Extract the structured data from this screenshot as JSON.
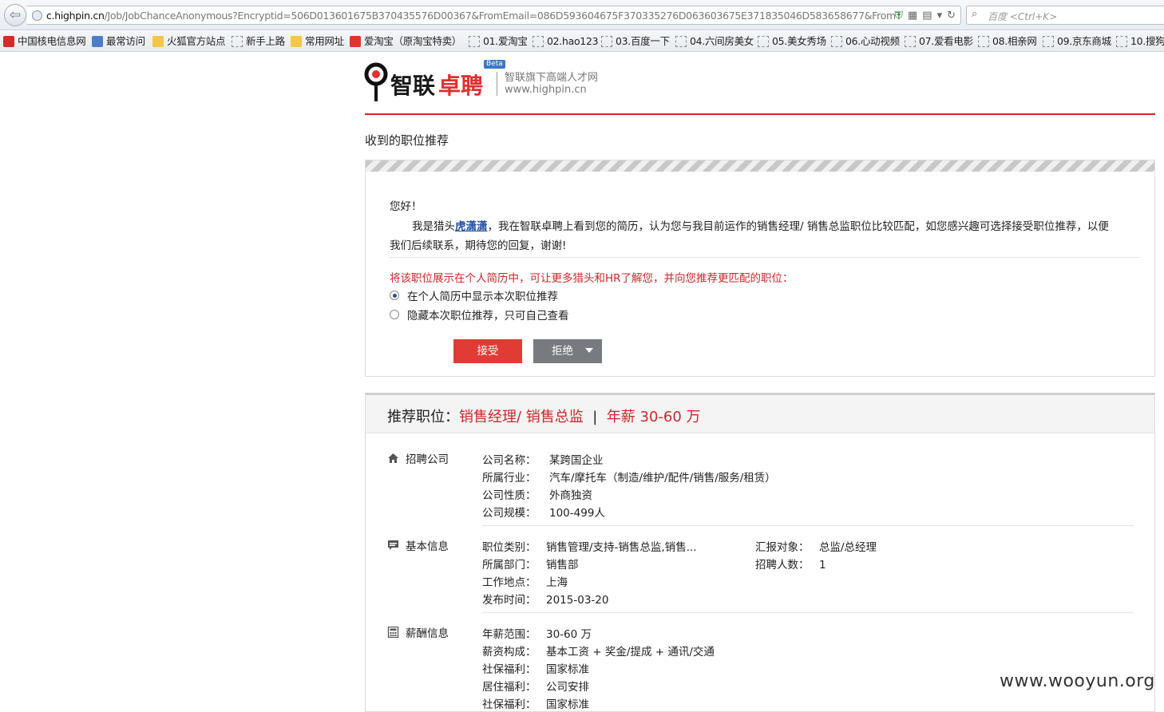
{
  "browser": {
    "url_host": "c.highpin.cn",
    "url_path": "/Job/JobChanceAnonymous?Encryptid=506D013601675B370435576D00367&FromEmail=086D593604675F370335276D063603675E371835046D583658677&FromType=",
    "search_placeholder": "百度 <Ctrl+K>"
  },
  "bookmarks": [
    {
      "label": "中国核电信息网",
      "icon": "red"
    },
    {
      "label": "最常访问",
      "icon": "blue"
    },
    {
      "label": "火狐官方站点",
      "icon": "folder"
    },
    {
      "label": "新手上路",
      "icon": "blank"
    },
    {
      "label": "常用网址",
      "icon": "folder"
    },
    {
      "label": "爱淘宝（原淘宝特卖）",
      "icon": "tao"
    },
    {
      "label": "01.爱淘宝",
      "icon": "blank"
    },
    {
      "label": "02.hao123",
      "icon": "blank"
    },
    {
      "label": "03.百度一下",
      "icon": "blank"
    },
    {
      "label": "04.六间房美女",
      "icon": "blank"
    },
    {
      "label": "05.美女秀场",
      "icon": "blank"
    },
    {
      "label": "06.心动视频",
      "icon": "blank"
    },
    {
      "label": "07.爱看电影",
      "icon": "blank"
    },
    {
      "label": "08.相亲网",
      "icon": "blank"
    },
    {
      "label": "09.京东商城",
      "icon": "blank"
    },
    {
      "label": "10.搜狗",
      "icon": "blank"
    }
  ],
  "logo": {
    "name_a": "智联",
    "name_b": "卓聘",
    "beta": "Beta",
    "slogan": "智联旗下高端人才网",
    "domain": "www.highpin.cn"
  },
  "page_title": "收到的职位推荐",
  "message": {
    "greeting": "您好！",
    "p1_before": "我是猎头",
    "hunter_name": "虎潇潇",
    "p1_after": "，我在智联卓聘上看到您的简历，认为您与我目前运作的销售经理/ 销售总监职位比较匹配，如您感兴趣可选择接受职位推荐，以便",
    "p2": "我们后续联系，期待您的回复，谢谢!",
    "prompt": "将该职位展示在个人简历中，可让更多猎头和HR了解您，并向您推荐更匹配的职位：",
    "option_show": "在个人简历中显示本次职位推荐",
    "option_hide": "隐藏本次职位推荐，只可自己查看",
    "accept": "接受",
    "reject": "拒绝"
  },
  "job": {
    "head_label": "推荐职位：",
    "title": "销售经理/ 销售总监",
    "bar": "|",
    "salary": "年薪 30-60 万",
    "company": {
      "section": "招聘公司",
      "rows": [
        {
          "k": "公司名称：",
          "v": "某跨国企业"
        },
        {
          "k": "所属行业：",
          "v": "汽车/摩托车（制造/维护/配件/销售/服务/租赁）"
        },
        {
          "k": "公司性质：",
          "v": "外商独资"
        },
        {
          "k": "公司规模：",
          "v": "100-499人"
        }
      ]
    },
    "basic": {
      "section": "基本信息",
      "rows": [
        {
          "k": "职位类别：",
          "v": "销售管理/支持-销售总监,销售..."
        },
        {
          "k": "所属部门：",
          "v": "销售部"
        },
        {
          "k": "工作地点：",
          "v": "上海"
        },
        {
          "k": "发布时间：",
          "v": "2015-03-20"
        }
      ],
      "right_rows": [
        {
          "k": "汇报对象：",
          "v": "总监/总经理"
        },
        {
          "k": "招聘人数：",
          "v": "1"
        }
      ]
    },
    "pay": {
      "section": "薪酬信息",
      "rows": [
        {
          "k": "年薪范围：",
          "v": "30-60 万"
        },
        {
          "k": "薪资构成：",
          "v": "基本工资 + 奖金/提成 + 通讯/交通"
        },
        {
          "k": "社保福利：",
          "v": "国家标准"
        },
        {
          "k": "居住福利：",
          "v": "公司安排"
        },
        {
          "k": "社保福利：",
          "v": "国家标准"
        }
      ]
    }
  },
  "watermark": "www.wooyun.org"
}
